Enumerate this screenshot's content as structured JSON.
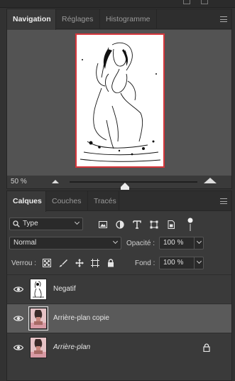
{
  "navigator_panel": {
    "tabs": [
      {
        "label": "Navigation",
        "active": true
      },
      {
        "label": "Réglages",
        "active": false
      },
      {
        "label": "Histogramme",
        "active": false
      }
    ],
    "zoom_value": "50 %",
    "zoom_level_fraction": 0.5,
    "view_frame_color": "#d7363b"
  },
  "layers_panel": {
    "tabs": [
      {
        "label": "Calques",
        "active": true
      },
      {
        "label": "Couches",
        "active": false
      },
      {
        "label": "Tracés",
        "active": false
      }
    ],
    "filter": {
      "label": "Type",
      "icons": [
        "image-filter-icon",
        "adjustment-filter-icon",
        "type-filter-icon",
        "shape-filter-icon",
        "smart-object-filter-icon",
        "filter-toggle-icon"
      ]
    },
    "blend_mode": "Normal",
    "opacity_label": "Opacité :",
    "opacity_value": "100 %",
    "lock_label": "Verrou :",
    "lock_icons": [
      "lock-transparent-icon",
      "lock-image-icon",
      "lock-position-icon",
      "lock-artboard-icon",
      "lock-all-icon"
    ],
    "fill_label": "Fond :",
    "fill_value": "100 %",
    "layers": [
      {
        "name": "Negatif",
        "visible": true,
        "selected": false,
        "italic": false,
        "locked": false
      },
      {
        "name": "Arrière-plan copie",
        "visible": true,
        "selected": true,
        "italic": false,
        "locked": false
      },
      {
        "name": "Arrière-plan",
        "visible": true,
        "selected": false,
        "italic": true,
        "locked": true
      }
    ]
  }
}
